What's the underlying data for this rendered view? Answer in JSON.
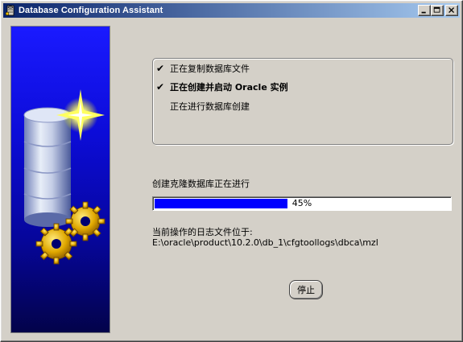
{
  "window": {
    "title": "Database Configuration Assistant",
    "icon": "dbca-app-icon"
  },
  "titlebar_buttons": {
    "minimize": "minimize-icon",
    "maximize": "maximize-icon",
    "close": "close-icon"
  },
  "steps": [
    {
      "label": "正在复制数据库文件",
      "checked": true,
      "bold": false
    },
    {
      "label": "正在创建并启动 Oracle 实例",
      "checked": true,
      "bold": true
    },
    {
      "label": "正在进行数据库创建",
      "checked": false,
      "bold": false
    }
  ],
  "check_glyph": "✔",
  "progress": {
    "caption": "创建克隆数据库正在进行",
    "percent_text": "45%",
    "fraction": 0.45
  },
  "log": {
    "label": "当前操作的日志文件位于:",
    "path": "E:\\oracle\\product\\10.2.0\\db_1\\cfgtoollogs\\dbca\\mzl"
  },
  "buttons": {
    "stop_label": "停止"
  },
  "colors": {
    "titlebar_start": "#0a246a",
    "titlebar_end": "#a6caf0",
    "progress_fill": "#0000ff",
    "banner_blue": "#1a1aff"
  }
}
